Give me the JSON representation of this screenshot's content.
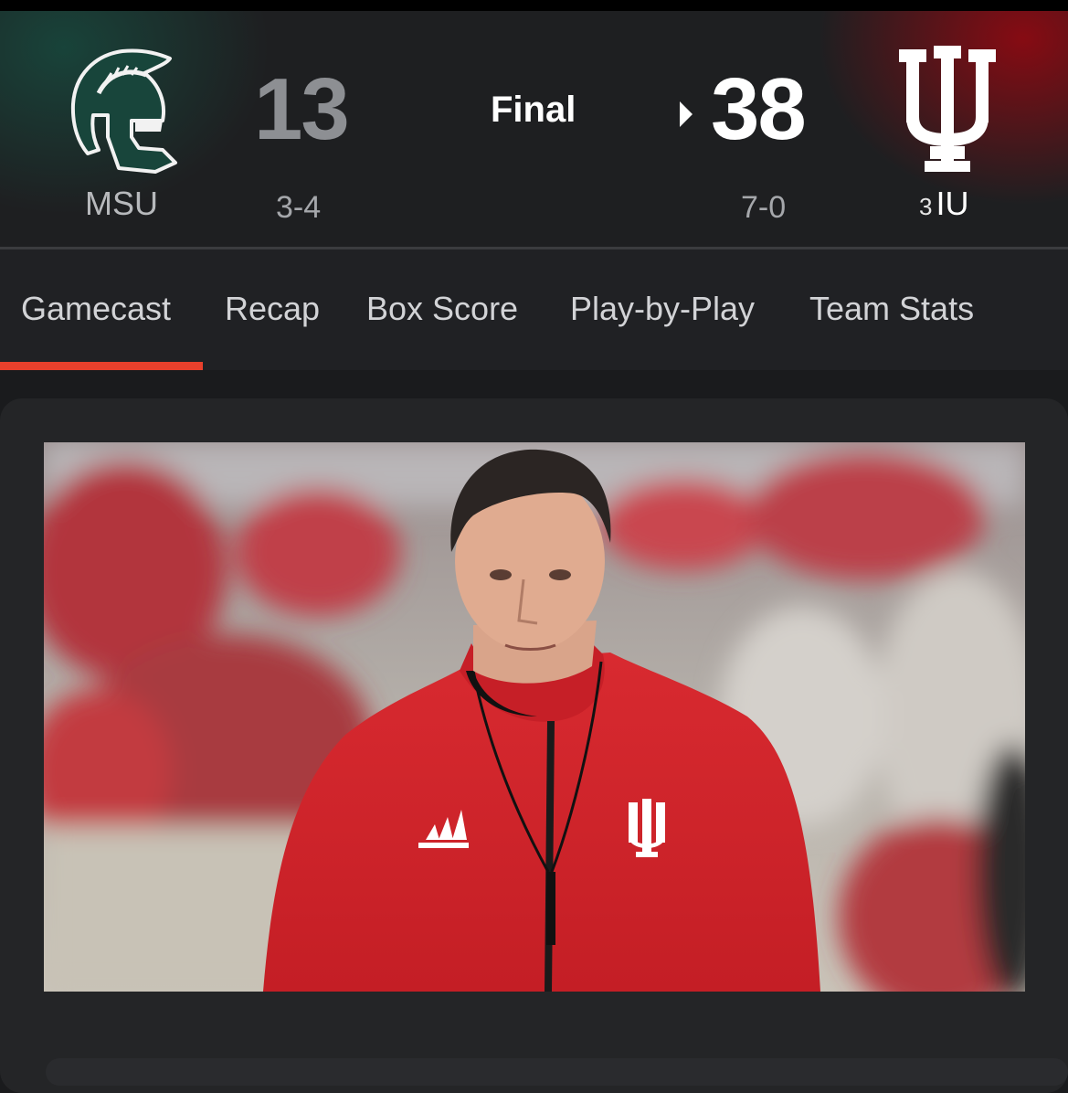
{
  "game": {
    "status": "Final",
    "away": {
      "abbr": "MSU",
      "score": "13",
      "record": "3-4",
      "color": "#18453b",
      "logo_icon": "spartan-helmet-icon"
    },
    "home": {
      "abbr": "IU",
      "rank": "3",
      "score": "38",
      "record": "7-0",
      "color": "#990000",
      "logo_icon": "iu-trident-icon",
      "winner": true
    }
  },
  "tabs": [
    {
      "label": "Gamecast",
      "active": true
    },
    {
      "label": "Recap"
    },
    {
      "label": "Box Score"
    },
    {
      "label": "Play-by-Play"
    },
    {
      "label": "Team Stats"
    }
  ],
  "accent_color": "#e8402c",
  "story": {
    "photo_icon": "coach-photo"
  }
}
